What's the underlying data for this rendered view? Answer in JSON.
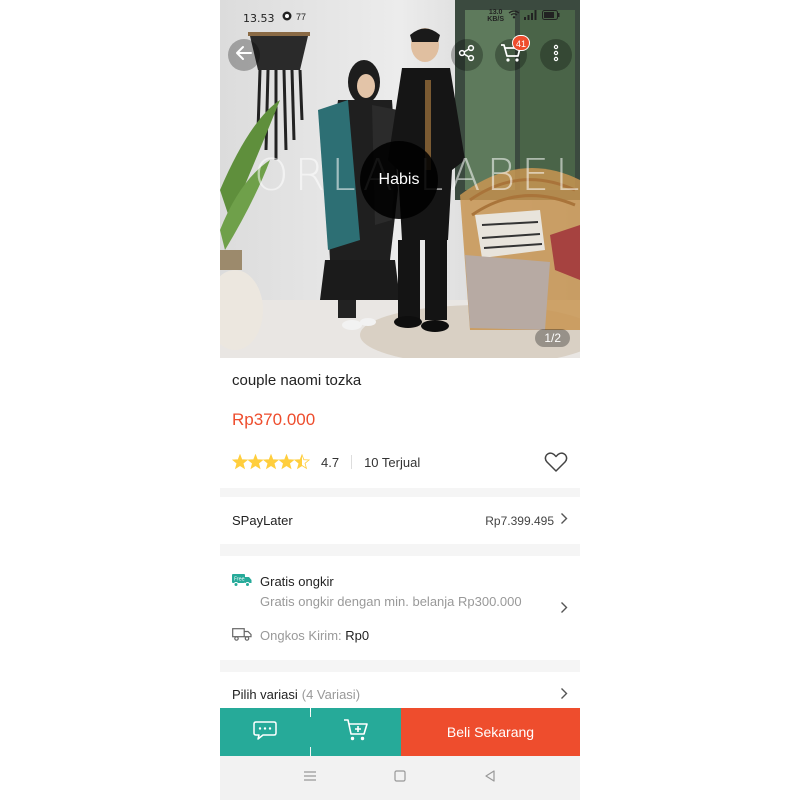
{
  "status_bar": {
    "time": "13.53",
    "notification_count": "77",
    "net_speed": "13.0",
    "net_unit": "KB/S",
    "battery_icon": "battery-icon"
  },
  "hero": {
    "watermark": "ORLA LABEL",
    "stock_status": "Habis",
    "image_counter": "1/2",
    "cart_badge": "41",
    "icons": {
      "back": "back-arrow-icon",
      "share": "share-icon",
      "cart": "cart-icon",
      "more": "more-vertical-icon"
    }
  },
  "product": {
    "name": "couple naomi tozka",
    "price": "Rp370.000",
    "rating": "4.7",
    "rating_stars": 4.5,
    "sold": "10 Terjual"
  },
  "paylater": {
    "label": "SPayLater",
    "value": "Rp7.399.495"
  },
  "shipping": {
    "free_title": "Gratis ongkir",
    "free_subtitle": "Gratis ongkir dengan min. belanja Rp300.000",
    "cost_label": "Ongkos Kirim:",
    "cost_value": "Rp0"
  },
  "variants": {
    "label": "Pilih variasi",
    "count": "(4 Variasi)"
  },
  "bottom_bar": {
    "buy_label": "Beli Sekarang"
  },
  "colors": {
    "accent": "#ee4d2d",
    "teal": "#26aa99",
    "star": "#ffce3d"
  }
}
